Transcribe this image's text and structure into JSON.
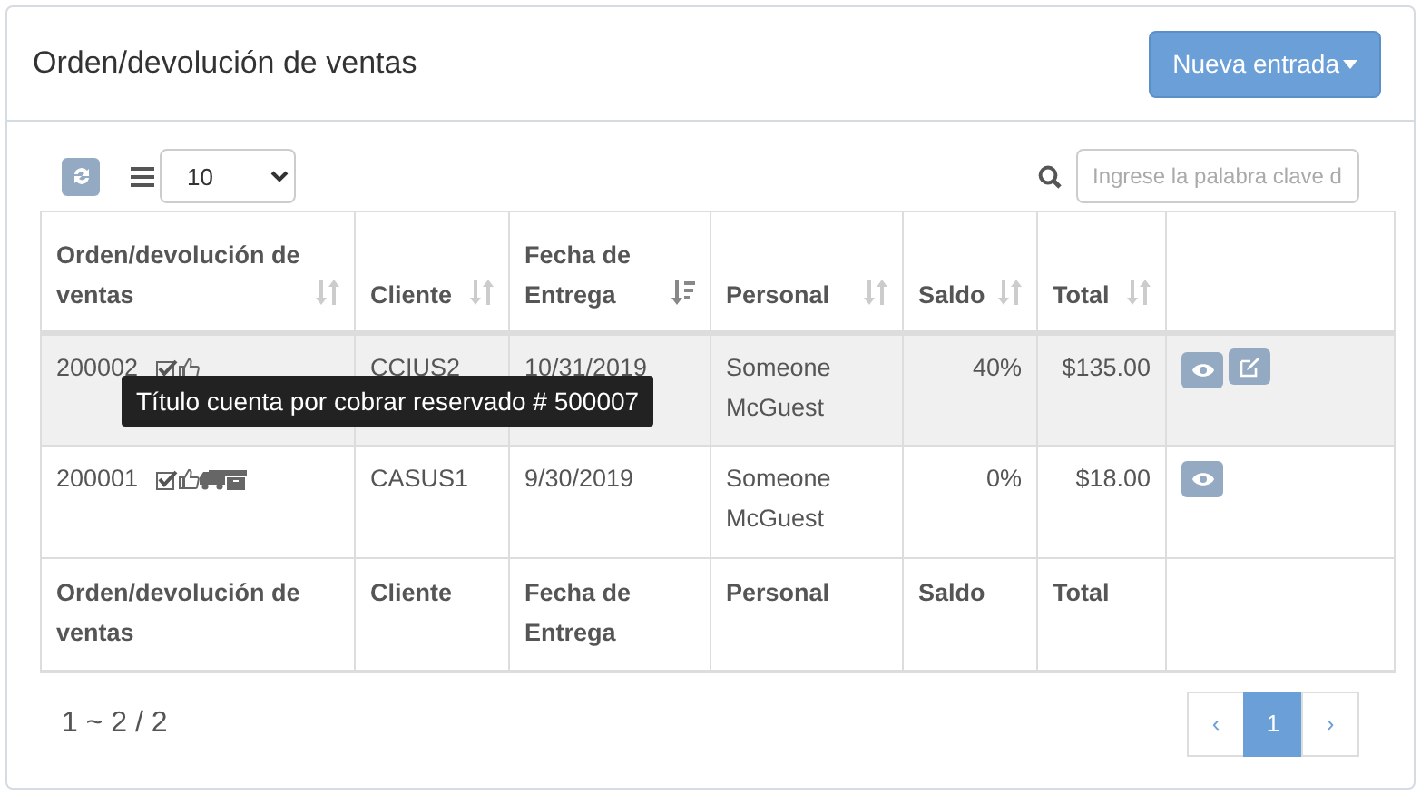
{
  "panel": {
    "title": "Orden/devolución de ventas",
    "new_button": "Nueva entrada"
  },
  "toolbar": {
    "page_size": "10",
    "search": {
      "placeholder": "Ingrese la palabra clave d"
    }
  },
  "table": {
    "columns": [
      {
        "label": "Orden/devolución de ventas",
        "sortable": true,
        "sorted": false
      },
      {
        "label": "Cliente",
        "sortable": true,
        "sorted": false
      },
      {
        "label": "Fecha de Entrega",
        "sortable": true,
        "sorted": true
      },
      {
        "label": "Personal",
        "sortable": true,
        "sorted": false
      },
      {
        "label": "Saldo",
        "sortable": true,
        "sorted": false
      },
      {
        "label": "Total",
        "sortable": true,
        "sorted": false
      },
      {
        "sortable": false
      }
    ],
    "rows": [
      {
        "order": "200002",
        "status_icons": [
          {
            "kind": "check"
          },
          {
            "kind": "thumb"
          }
        ],
        "client": "CCIUS2",
        "date": "10/31/2019",
        "staff": "Someone McGuest",
        "balance": "40%",
        "total": "$135.00",
        "actions": [
          {
            "kind": "view"
          },
          {
            "kind": "edit"
          }
        ],
        "hovered": true,
        "tooltip": "Título cuenta por cobrar reservado # 500007"
      },
      {
        "order": "200001",
        "status_icons": [
          {
            "kind": "check"
          },
          {
            "kind": "thumb"
          },
          {
            "kind": "truck"
          },
          {
            "kind": "archive"
          }
        ],
        "client": "CASUS1",
        "date": "9/30/2019",
        "staff": "Someone McGuest",
        "balance": "0%",
        "total": "$18.00",
        "actions": [
          {
            "kind": "view"
          }
        ],
        "hovered": false
      }
    ],
    "footer": [
      "Orden/devolución de ventas",
      "Cliente",
      "Fecha de Entrega",
      "Personal",
      "Saldo",
      "Total"
    ]
  },
  "pagination": {
    "summary": "1 ~ 2 / 2",
    "pages": [
      {
        "label": "‹",
        "selected": false
      },
      {
        "label": "1",
        "selected": true
      },
      {
        "label": "›",
        "selected": false
      }
    ]
  }
}
